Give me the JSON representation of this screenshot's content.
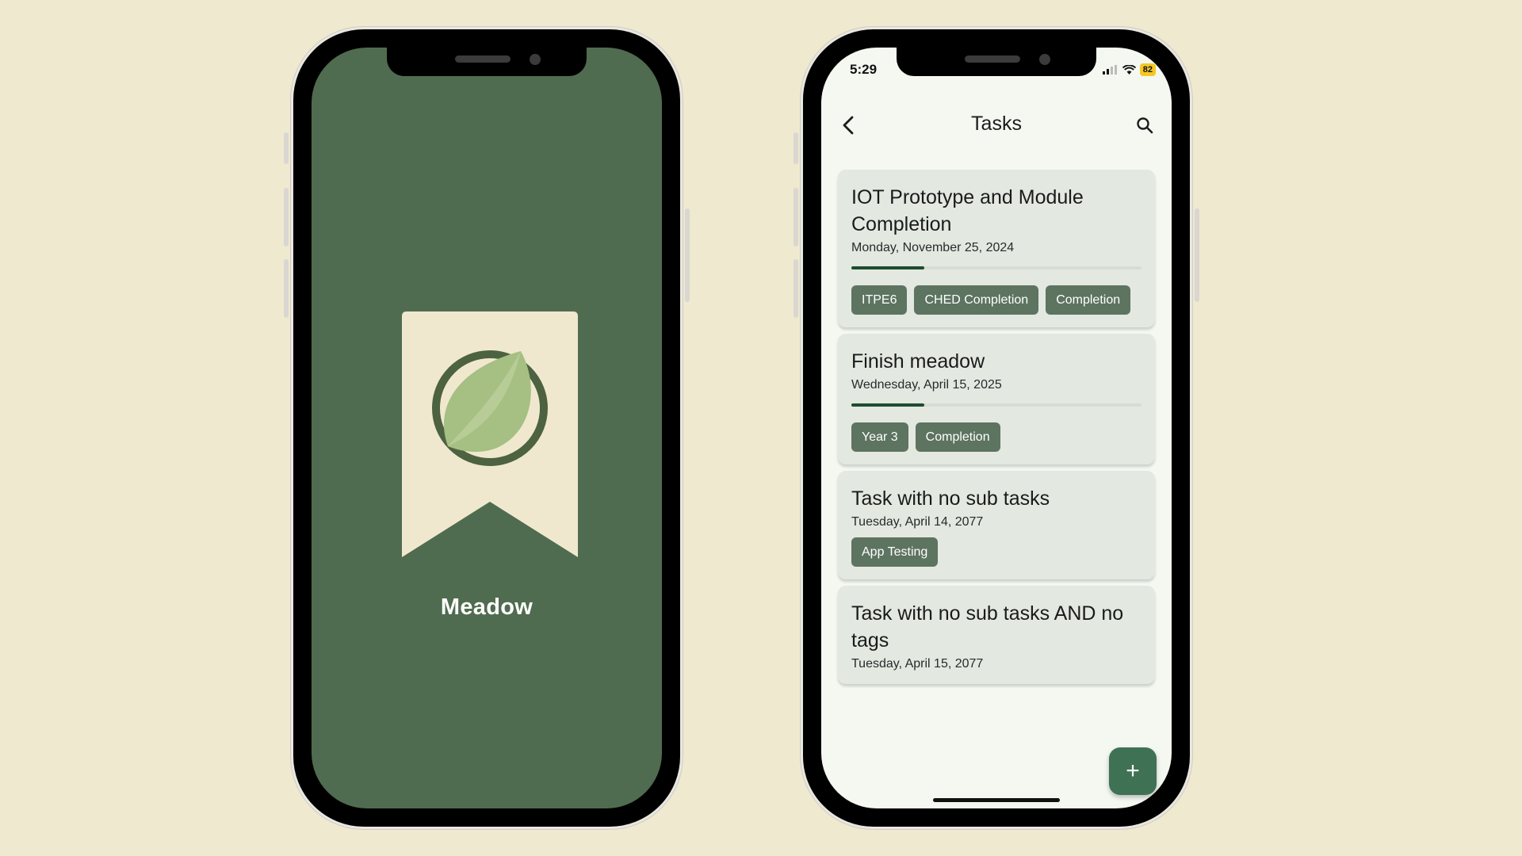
{
  "splash": {
    "app_name": "Meadow",
    "background_color": "#506c50",
    "logo_icon": "leaf-bookmark-icon"
  },
  "status_bar": {
    "time": "5:29",
    "battery": "82"
  },
  "header": {
    "title": "Tasks",
    "back_icon": "chevron-left-icon",
    "search_icon": "search-icon"
  },
  "tasks": [
    {
      "title": "IOT Prototype and Module Completion",
      "date": "Monday, November 25, 2024",
      "progress": 0.25,
      "tags": [
        "ITPE6",
        "CHED Completion",
        "Completion"
      ]
    },
    {
      "title": "Finish meadow",
      "date": "Wednesday, April 15, 2025",
      "progress": 0.25,
      "tags": [
        "Year 3",
        "Completion"
      ]
    },
    {
      "title": "Task with no sub tasks",
      "date": "Tuesday, April 14, 2077",
      "tags": [
        "App Testing"
      ]
    },
    {
      "title": "Task with no sub tasks AND no tags",
      "date": "Tuesday, April 15, 2077"
    }
  ],
  "fab": {
    "label": "+",
    "icon": "plus-icon"
  },
  "colors": {
    "page_background": "#efe9d0",
    "accent": "#3f7255",
    "tag_background": "#5d7460",
    "card_background": "#e3e8e1",
    "progress_fill": "#1f4b2e"
  }
}
